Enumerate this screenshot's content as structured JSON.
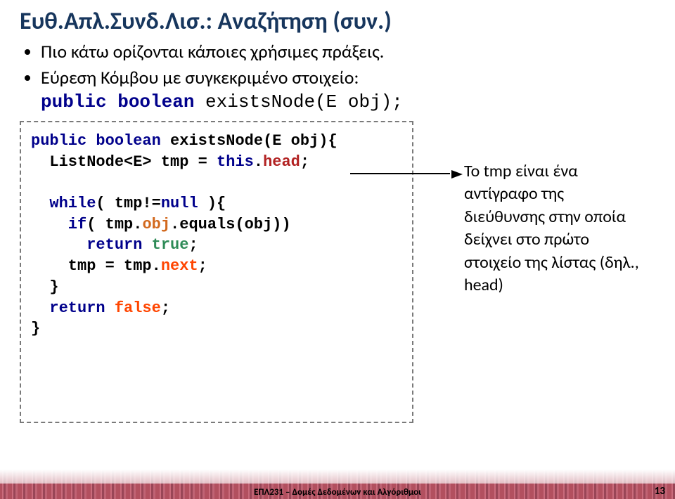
{
  "title": "Ευθ.Απλ.Συνδ.Λισ.: Αναζήτηση (συν.)",
  "bullet1": "Πιο κάτω ορίζονται κάποιες χρήσιμες πράξεις.",
  "bullet2": "Εύρεση Κόμβου με συγκεκριμένο στοιχείο:",
  "signature": {
    "kw1": "public boolean",
    "fn": " existsNode(E obj);"
  },
  "code": {
    "l1_kw": "public boolean",
    "l1_rest": " existsNode(E obj){",
    "l2_a": "  ListNode<E> tmp = ",
    "l2_b": "this",
    "l2_c": ".",
    "l2_d": "head",
    "l2_e": ";",
    "blank": " ",
    "l3_a": "  while",
    "l3_b": "( tmp!=",
    "l3_c": "null",
    "l3_d": " ){",
    "l4_a": "    if",
    "l4_b": "( tmp.",
    "l4_c": "obj",
    "l4_d": ".equals(obj))",
    "l5_a": "      return ",
    "l5_b": "true",
    "l5_c": ";",
    "l6_a": "    tmp = tmp.",
    "l6_b": "next",
    "l6_c": ";",
    "l7": "  }",
    "l8_a": "  return ",
    "l8_b": "false",
    "l8_c": ";",
    "l9": "}"
  },
  "annotation": "Το tmp είναι ένα αντίγραφο της διεύθυνσης στην οποία δείχνει στο πρώτο στοιχείο της λίστας (δηλ., head)",
  "footer": "ΕΠΛ231 – Δομές Δεδομένων και Αλγόριθμοι",
  "pagenum": "13"
}
